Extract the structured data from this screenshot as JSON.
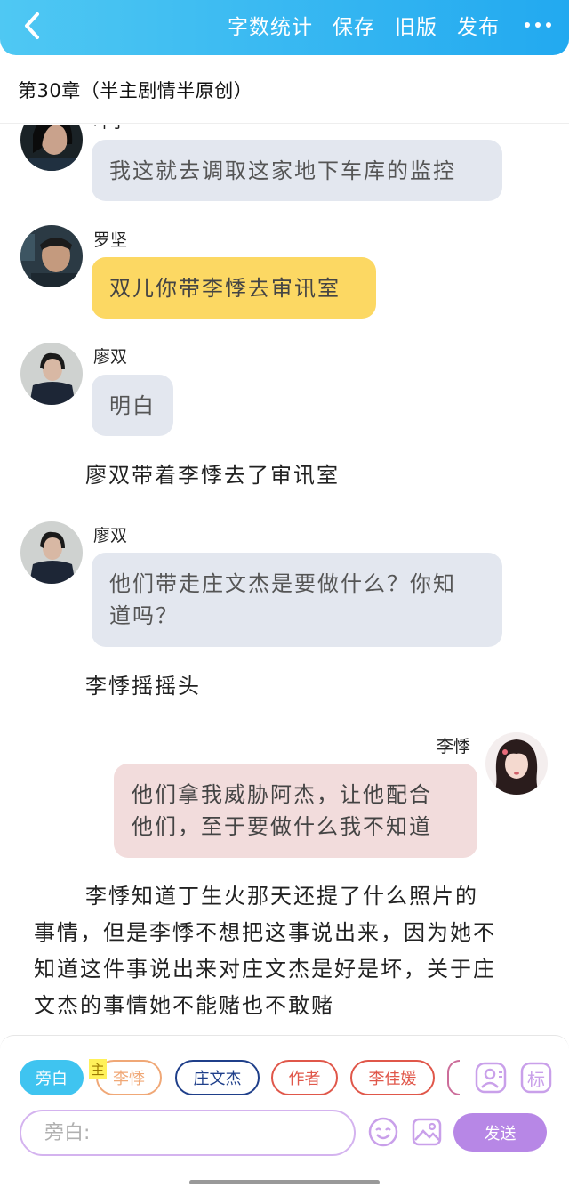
{
  "header": {
    "actions": [
      "字数统计",
      "保存",
      "旧版",
      "发布"
    ]
  },
  "chapter": {
    "title": "第30章（半主剧情半原创）"
  },
  "messages": [
    {
      "name": "叶子",
      "text": "我这就去调取这家地下车库的监控"
    },
    {
      "name": "罗坚",
      "text": "双儿你带李悸去审讯室"
    },
    {
      "name": "廖双",
      "text": "明白"
    },
    {
      "name": "廖双",
      "text_line1": "他们带走庄文杰是要做什么？你知",
      "text_line2": "道吗？"
    },
    {
      "name": "李悸",
      "text_line1": "他们拿我威胁阿杰，让他配合",
      "text_line2": "他们，至于要做什么我不知道"
    }
  ],
  "narrations": [
    "廖双带着李悸去了审讯室",
    "李悸摇摇头"
  ],
  "long_narration": [
    "李悸知道丁生火那天还提了什么照片的",
    "事情，但是李悸不想把这事说出来，因为她不",
    "知道这件事说出来对庄文杰是好是坏，关于庄",
    "文杰的事情她不能赌也不敢赌"
  ],
  "roles": {
    "main_tag": "主",
    "chips": [
      {
        "label": "旁白",
        "active": true,
        "color": "#3fc4f0"
      },
      {
        "label": "李悸",
        "active": false,
        "color": "#f0a877"
      },
      {
        "label": "庄文杰",
        "active": false,
        "color": "#1f3f8a"
      },
      {
        "label": "作者",
        "active": false,
        "color": "#e0574a"
      },
      {
        "label": "李佳媛",
        "active": false,
        "color": "#e0574a"
      }
    ],
    "icons": [
      "role-manage-icon",
      "mark-icon"
    ],
    "mark_label": "标"
  },
  "composer": {
    "placeholder": "旁白:",
    "send_label": "发送",
    "icons": [
      "emoji-icon",
      "image-icon"
    ]
  },
  "colors": {
    "accent": "#22a9f0",
    "bubble_gray": "#e3e7ef",
    "bubble_yellow": "#fcd863",
    "bubble_pink": "#f2dcdc",
    "send_button": "#b787e6"
  }
}
